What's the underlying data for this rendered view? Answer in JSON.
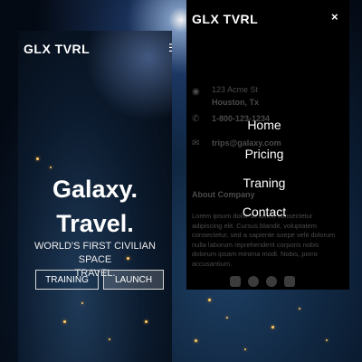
{
  "phone1": {
    "brand": "GLX TVRL",
    "headline_line1": "Galaxy.",
    "headline_line2": "Travel.",
    "subtitle_line1": "WORLD'S FIRST CIVILIAN SPACE",
    "subtitle_line2": "TRAVEL.",
    "buttons": {
      "training": "TRAINING",
      "launch": "LAUNCH"
    },
    "menu_icon": "hamburger-icon"
  },
  "phone2": {
    "brand": "GLX TVRL",
    "close_symbol": "×",
    "menu": [
      "Home",
      "Pricing",
      "Traning",
      "Contact"
    ],
    "contact": {
      "address_line1": "123 Acme St",
      "address_line2": "Houston, Tx",
      "phone": "1-800-123-1234",
      "email": "trips@galaxy.com"
    },
    "about_heading": "About Company",
    "about_text": "Lorem ipsum dolor sit amet, consectetur adipiscing elit. Cursus blandit, voluptatem consectetur, sed a sapiente soepe velit dolorum nulla laborum reprehenderit corporis nobis dolorum ipsam minima modi. Nobis, porro accusantium.",
    "social_icons": [
      "linkedin-icon",
      "github-icon",
      "facebook-icon",
      "twitter-icon"
    ]
  },
  "colors": {
    "accent": "#ffffff",
    "overlay": "#000000",
    "city_lights": "#ffcf66"
  }
}
